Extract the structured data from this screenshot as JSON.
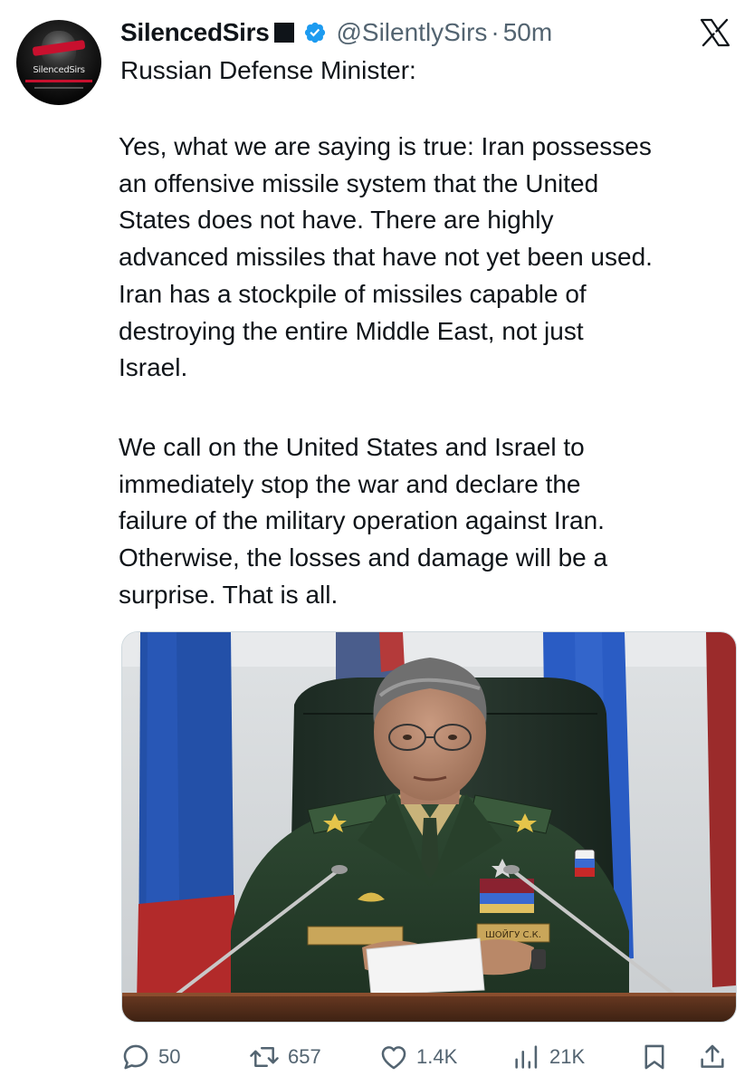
{
  "author": {
    "display_name": "SilencedSirs",
    "handle": "@SilentlySirs",
    "separator": "·",
    "time": "50m",
    "avatar_text": "SilencedSirs"
  },
  "platform": {
    "logo_icon": "x-logo-icon"
  },
  "tweet": {
    "heading": "Russian Defense Minister:",
    "paragraph_1": "Yes, what we are saying is true: Iran possesses\nan offensive missile system that the United\nStates does not have. There are highly\nadvanced missiles that have not yet been used.\nIran has a stockpile of missiles capable of\ndestroying the entire Middle East, not just\nIsrael.",
    "paragraph_2": "We call on the United States and Israel to\nimmediately stop the war and declare the\nfailure of the military operation against Iran.\nOtherwise, the losses and damage will be a\nsurprise. That is all.",
    "photo": {
      "desk_nameplate": "ШОЙГУ С.К."
    }
  },
  "metrics": {
    "replies": "50",
    "reposts": "657",
    "likes": "1.4K",
    "views": "21K"
  },
  "colors": {
    "text": "#0f1419",
    "secondary": "#536471",
    "verified": "#1d9bf0"
  }
}
